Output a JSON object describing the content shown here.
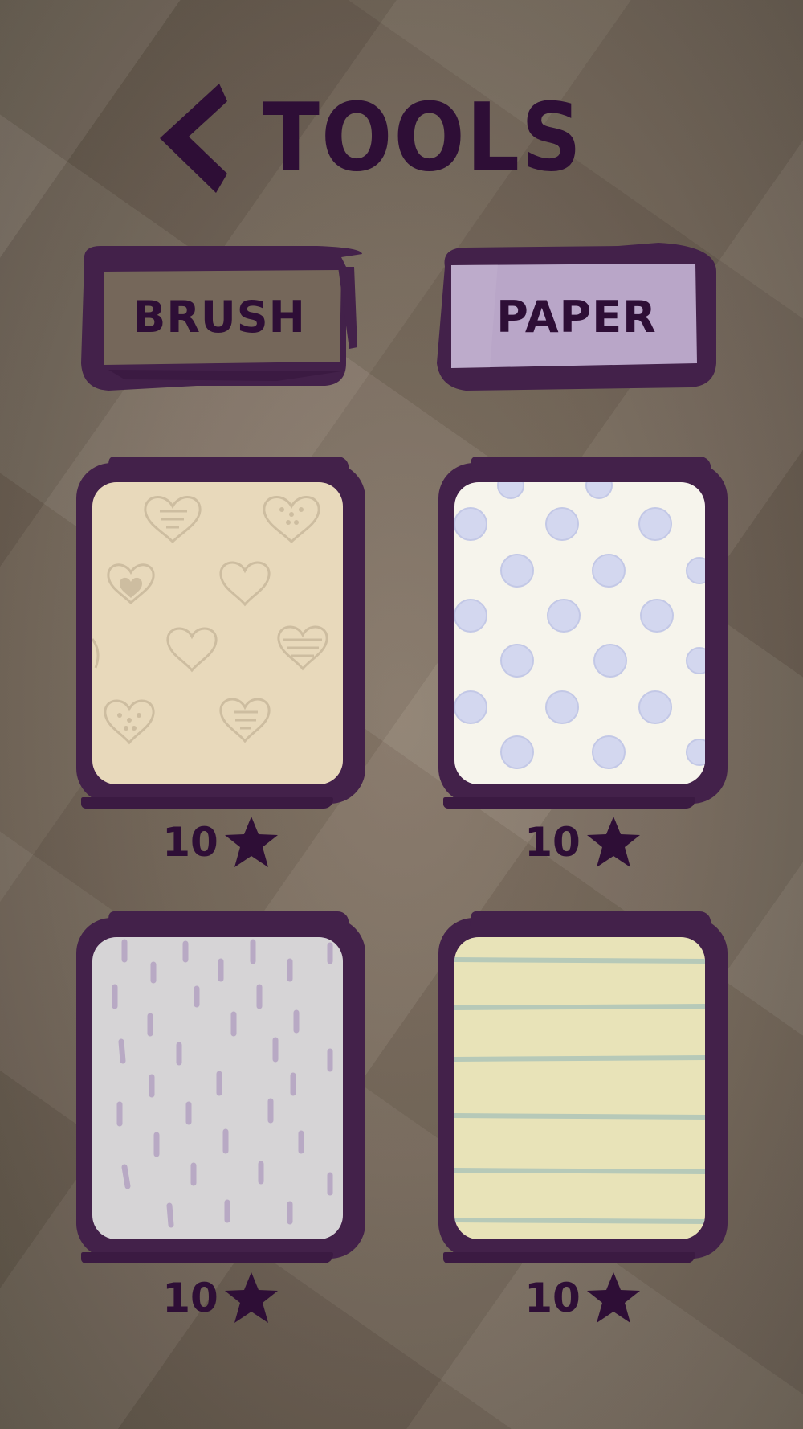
{
  "header": {
    "title": "TOOLS",
    "back_icon": "chevron-left-icon"
  },
  "tabs": [
    {
      "label": "BRUSH",
      "selected": false
    },
    {
      "label": "PAPER",
      "selected": true
    }
  ],
  "colors": {
    "ink": "#2e0e36",
    "frame": "#43214a",
    "tab_selected_fill": "#b9a6c8",
    "background": "#7a6c5e"
  },
  "papers": [
    {
      "pattern": "hearts",
      "background": "#e8d9bb",
      "motif_color": "#cdbda0",
      "price": "10",
      "price_icon": "star-icon"
    },
    {
      "pattern": "scribble-dots",
      "background": "#f6f4ec",
      "motif_color": "#c3c8e6",
      "price": "10",
      "price_icon": "star-icon"
    },
    {
      "pattern": "dashes",
      "background": "#d6d4d6",
      "motif_color": "#b8a9c4",
      "price": "10",
      "price_icon": "star-icon"
    },
    {
      "pattern": "ruled-lines",
      "background": "#e8e3b8",
      "motif_color": "#b6c9b8",
      "price": "10",
      "price_icon": "star-icon"
    }
  ]
}
